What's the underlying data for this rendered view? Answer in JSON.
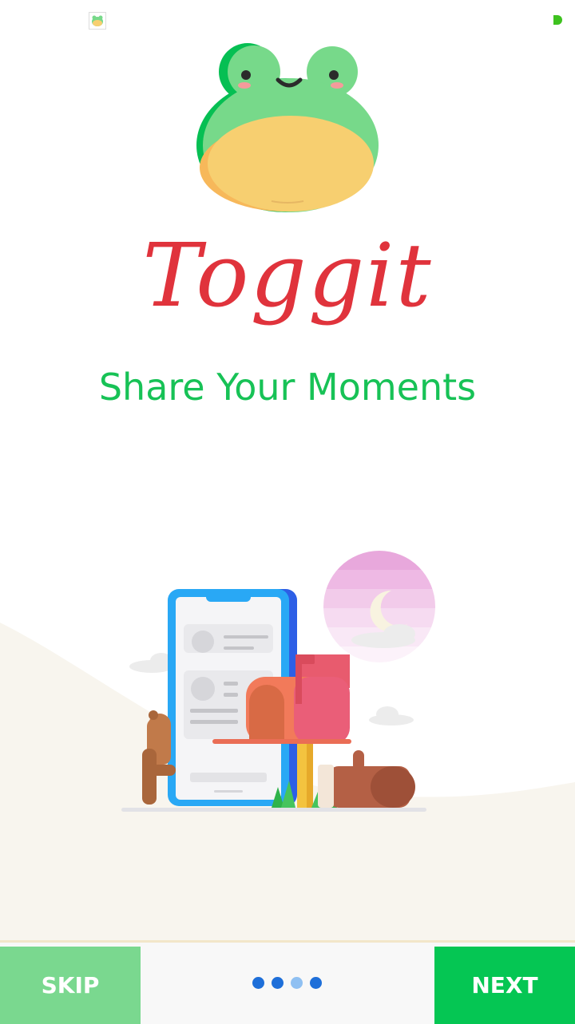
{
  "status_bar": {
    "icons": [
      "frog-app-icon",
      "notification-dot-icon"
    ]
  },
  "brand": {
    "app_name": "Toggit",
    "tagline": "Share Your Moments",
    "colors": {
      "name": "#e0333c",
      "tagline": "#17c256",
      "frog_green": "#77d98a",
      "frog_belly": "#f7cf70"
    }
  },
  "illustration": {
    "icon": "phone-mailbox-illustration"
  },
  "bottom_nav": {
    "skip_label": "SKIP",
    "next_label": "NEXT",
    "page_count": 4,
    "current_page": 3,
    "colors": {
      "skip": "#7ad88f",
      "next": "#05c653",
      "dot": "#1e6fd9",
      "dot_active": "#8fc0f2"
    }
  }
}
